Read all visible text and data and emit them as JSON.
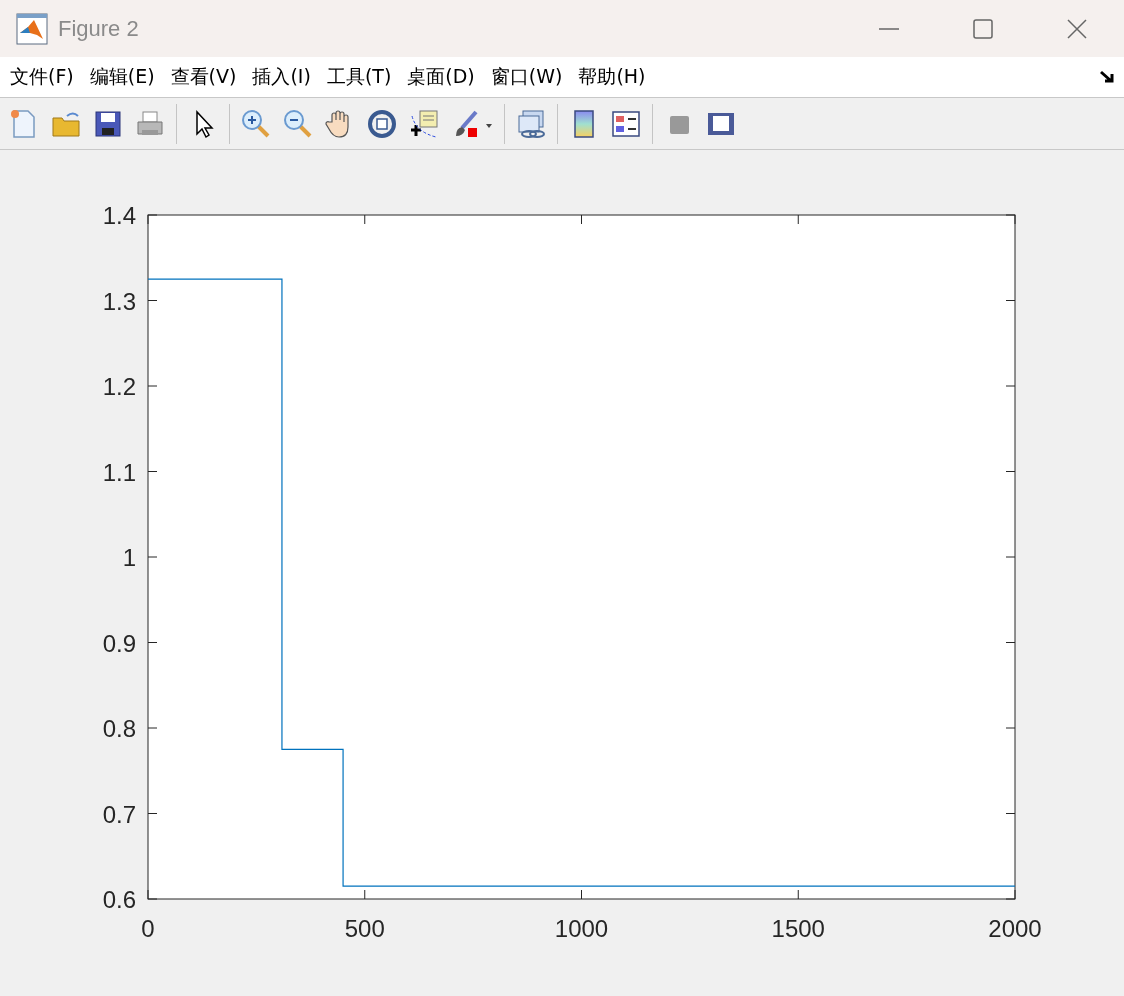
{
  "window": {
    "title": "Figure 2"
  },
  "menu": [
    {
      "label": "文件(F)"
    },
    {
      "label": "编辑(E)"
    },
    {
      "label": "查看(V)"
    },
    {
      "label": "插入(I)"
    },
    {
      "label": "工具(T)"
    },
    {
      "label": "桌面(D)"
    },
    {
      "label": "窗口(W)"
    },
    {
      "label": "帮助(H)"
    }
  ],
  "figure": {
    "chart_data": {
      "type": "line",
      "x": [
        0,
        309,
        309,
        450,
        450,
        2000
      ],
      "series": [
        {
          "color": "#0072bd",
          "values": [
            1.325,
            1.325,
            0.775,
            0.775,
            0.615,
            0.615
          ]
        }
      ],
      "xlim": [
        0,
        2000
      ],
      "ylim": [
        0.6,
        1.4
      ],
      "xticks": [
        0,
        500,
        1000,
        1500,
        2000
      ],
      "yticks": [
        {
          "value": 0.6,
          "label": "0.6"
        },
        {
          "value": 0.7,
          "label": "0.7"
        },
        {
          "value": 0.8,
          "label": "0.8"
        },
        {
          "value": 0.9,
          "label": "0.9"
        },
        {
          "value": 1,
          "label": "1"
        },
        {
          "value": 1.1,
          "label": "1.1"
        },
        {
          "value": 1.2,
          "label": "1.2"
        },
        {
          "value": 1.3,
          "label": "1.3"
        },
        {
          "value": 1.4,
          "label": "1.4"
        }
      ]
    }
  }
}
